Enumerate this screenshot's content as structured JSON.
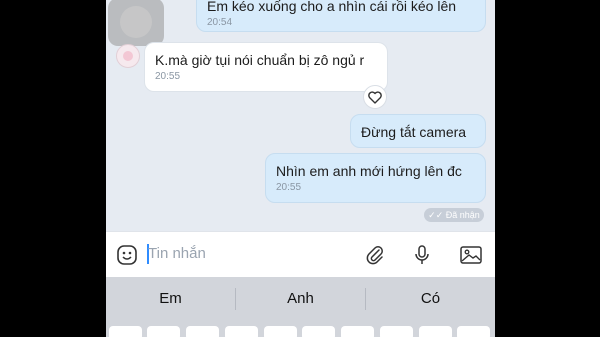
{
  "messages": [
    {
      "id": "m1",
      "direction": "outgoing",
      "text": "Em kéo xuống cho a nhìn cái rồi kéo lên",
      "time": "20:54"
    },
    {
      "id": "m2",
      "direction": "incoming",
      "text": "K.mà giờ tụi nói chuẩn bị zô ngủ r",
      "time": "20:55"
    },
    {
      "id": "m3",
      "direction": "outgoing",
      "text": "Đừng tắt camera",
      "time": ""
    },
    {
      "id": "m4",
      "direction": "outgoing",
      "text": "Nhìn em anh mới hứng lên đc",
      "time": "20:55"
    }
  ],
  "status": {
    "seen_label": "Đã nhận"
  },
  "composer": {
    "placeholder": "Tin nhắn"
  },
  "keyboard": {
    "suggestions": [
      "Em",
      "Anh",
      "Có"
    ]
  },
  "colors": {
    "outgoing_bubble": "#d7ebfb",
    "incoming_bubble": "#ffffff",
    "chat_background": "#e6ebf2",
    "keyboard": "#d2d5db"
  },
  "icons": [
    "overlay-circle-icon",
    "avatar",
    "heart-icon",
    "sticker-icon",
    "attach-icon",
    "mic-icon",
    "image-icon",
    "double-check-icon"
  ]
}
